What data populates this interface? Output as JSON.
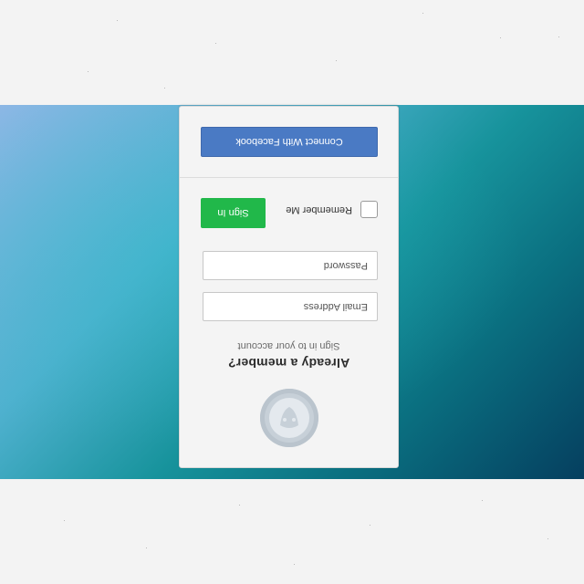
{
  "login": {
    "title": "Already a member?",
    "subtitle": "Sign in to your account",
    "email_placeholder": "Email Address",
    "password_placeholder": "Password",
    "remember_label": "Remember Me",
    "signin_label": "Sign In",
    "facebook_label": "Connect With Facebook",
    "avatar_icon": "user-avatar-icon"
  },
  "colors": {
    "signin_button": "#21b84a",
    "facebook_button": "#4a7ac4",
    "card_background": "#f4f4f4"
  }
}
